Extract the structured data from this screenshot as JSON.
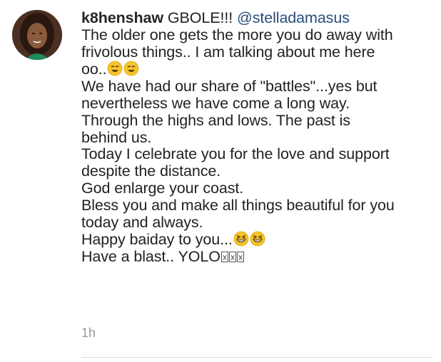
{
  "comment": {
    "username": "k8henshaw",
    "greeting": "GBOLE!!!",
    "mention": "@stelladamasus",
    "lines": [
      "The older one gets the more you do away with",
      "frivolous things.. I am talking about me here",
      "oo..",
      "We have had our share of \"battles\"...yes but",
      "nevertheless we have come a long way.",
      "Through the highs and lows. The past is",
      "behind us.",
      "Today I celebrate you for the love and support",
      "despite the distance.",
      "God enlarge your coast.",
      "Bless you and make all things beautiful for you",
      "today and always.",
      "Happy baiday to you...",
      "Have a blast.. YOLO"
    ],
    "emojis": {
      "line3": "sweat-smile-emoji",
      "line13": "grinning-squint-emoji",
      "line14": "unrendered-emoji-boxes"
    },
    "timestamp": "1h"
  },
  "colors": {
    "text": "#222222",
    "mention": "#2a4d7a",
    "timestamp": "#999999",
    "divider": "#dbdbdb",
    "emoji_face": "#f7c52b"
  }
}
